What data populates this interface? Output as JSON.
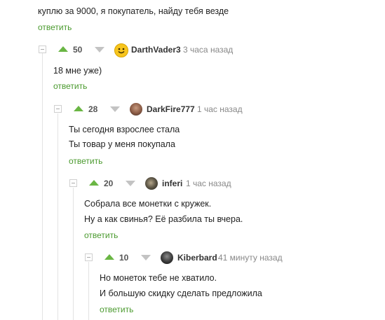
{
  "accent_color": "#4a9a2e",
  "top_comment": {
    "text": "куплю за 9000, я покупатель, найду тебя везде",
    "reply_label": "ответить"
  },
  "comments": [
    {
      "score": "50",
      "username": "DarthVader3",
      "time": "3 часа назад",
      "avatar": "smiley-face",
      "lines": [
        "18 мне уже)"
      ],
      "reply_label": "ответить"
    },
    {
      "score": "28",
      "username": "DarkFire777",
      "time": "1 час назад",
      "avatar": "user-photo",
      "lines": [
        "Ты сегодня взрослее стала",
        "Ты товар у меня покупала"
      ],
      "reply_label": "ответить"
    },
    {
      "score": "20",
      "username": "inferi",
      "time": "1 час назад",
      "avatar": "user-photo",
      "lines": [
        "Собрала все монетки с кружек.",
        "Ну а как свинья? Её разбила ты вчера."
      ],
      "reply_label": "ответить"
    },
    {
      "score": "10",
      "username": "Kiberbard",
      "time": "41 минуту назад",
      "avatar": "user-photo",
      "lines": [
        "Но монеток тебе не хватило.",
        "И большую скидку сделать предложила"
      ],
      "reply_label": "ответить"
    }
  ]
}
